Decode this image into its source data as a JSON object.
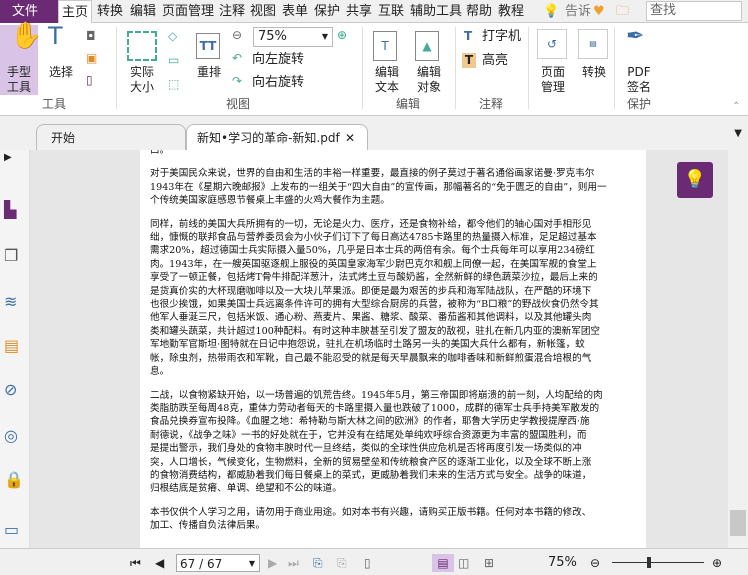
{
  "menu": {
    "file": "文件",
    "items": [
      "主页",
      "转换",
      "编辑",
      "页面管理",
      "注释",
      "视图",
      "表单",
      "保护",
      "共享",
      "互联",
      "辅助工具",
      "帮助",
      "教程"
    ],
    "tell": "告诉",
    "search_placeholder": "查找"
  },
  "ribbon": {
    "hand": "手型\n工具",
    "select": "选择",
    "tools_group": "工具",
    "actual": "实际\n大小",
    "reflow": "重排",
    "zoom": "75%",
    "rotate_left": "向左旋转",
    "rotate_right": "向右旋转",
    "view_group": "视图",
    "edit_text": "编辑\n文本",
    "edit_object": "编辑\n对象",
    "edit_group": "编辑",
    "typewriter": "打字机",
    "highlight": "高亮",
    "comment_group": "注释",
    "page_manage": "页面\n管理",
    "convert": "转换",
    "pdf_sign": "PDF\n签名",
    "protect_group": "保护"
  },
  "tabs": [
    {
      "label": "开始"
    },
    {
      "label": "新知•学习的革命-新知.pdf"
    }
  ],
  "document": {
    "paragraphs": [
      [
        "口。"
      ],
      [
        "对于美国民众来说，世界的自由和生活的丰裕一样重要，最直接的例子莫过于著名通俗画家诺曼·罗克韦尔",
        "1943年在《星期六晚邮报》上发布的一组关于“四大自由”的宣传画，那幅著名的“免于匮乏的自由”，则用一",
        "个传统美国家庭感恩节餐桌上丰盛的火鸡大餐作为主题。"
      ],
      [
        "同样，前线的美国大兵所拥有的一切，无论是火力、医疗，还是食物补给，都令他们的轴心国对手相形见",
        "绌，慷慨的联邦食品与营养委员会为小伙子们订下了每日高达4785卡路里的热量摄入标准，足足超过基本",
        "需求20%，超过德国士兵实际摄入量50%，几乎是日本士兵的两倍有余。每个士兵每年可以享用234磅红",
        "肉。1943年，在一艘英国驱逐舰上服役的英国皇家海军少尉巴克尔和舰上同僚一起，在美国军舰的食堂上",
        "享受了一顿正餐，包括烤T骨牛排配洋葱汁，法式烤土豆与酸奶酱，全然新鲜的绿色蔬菜沙拉，最后上来的",
        "是货真价实的大杯现磨咖啡以及一大块儿苹果派。即便是最为艰苦的步兵和海军陆战队，在严酷的环境下",
        "也很少挨饿，如果美国士兵远离条件许可的拥有大型综合厨房的兵营，被称为“B口粮”的野战伙食仍然令其",
        "他军人垂涎三尺，包括米饭、通心粉、燕麦片、果酱、糖浆、酸菜、番茄酱和其他调料，以及其他罐头肉",
        "类和罐头蔬菜，共计超过100种配料。有时这种丰腴甚至引发了盟友的敌视，驻扎在新几内亚的澳新军团空",
        "军地勤军官斯坦·图特就在日记中抱怨说，驻扎在机场临时土路另一头的美国大兵什么都有，新帐篷，蚊",
        "帐，除虫剂，热带雨衣和军靴，自己最不能忍受的就是每天早晨飘来的咖啡香味和新鲜煎蛋混合培根的气",
        "息。"
      ],
      [
        "二战，以食物紧缺开始，以一场普遍的饥荒告终。1945年5月，第三帝国即将崩溃的前一刻，人均配给的肉",
        "类脂肪跌至每周48克，重体力劳动者每天的卡路里摄入量也跌破了1000，成群的德军士兵手持美军散发的",
        "食品兑换券宣布投降。《血腥之地：希特勒与斯大林之间的欧洲》的作者，耶鲁大学历史学教授提摩西·施",
        "耐德说，《战争之味》一书的好处就在于，它并没有在结尾处单纯欢呼综合资源更为丰富的盟国胜利，而",
        "是提出警示，我们身处的食物丰腴时代一旦终结，类似的全球性供应危机是否将再度引发一场类似的冲",
        "突，人口增长，气候变化，生物燃料，全新的贸易壁垒和传统粮食产区的逐渐工业化，以及全球不断上涨",
        "的食物消费结构，都威胁着我们每日餐桌上的菜式，更威胁着我们未来的生活方式与安全。战争的味道，",
        "归根结底是贫瘠、单调、绝望和不公的味道。"
      ],
      [
        "本书仅供个人学习之用，请勿用于商业用途。如对本书有兴趣，请购买正版书籍。任何对本书籍的修改、",
        "加工、传播自负法律后果。"
      ]
    ]
  },
  "status": {
    "page": "67 / 67",
    "zoom": "75%",
    "zoom_slider_percent": 40
  },
  "colors": {
    "accent": "#6b2a74",
    "hand_active": "#d9c3e6",
    "icon_blue": "#3a6ea5"
  }
}
